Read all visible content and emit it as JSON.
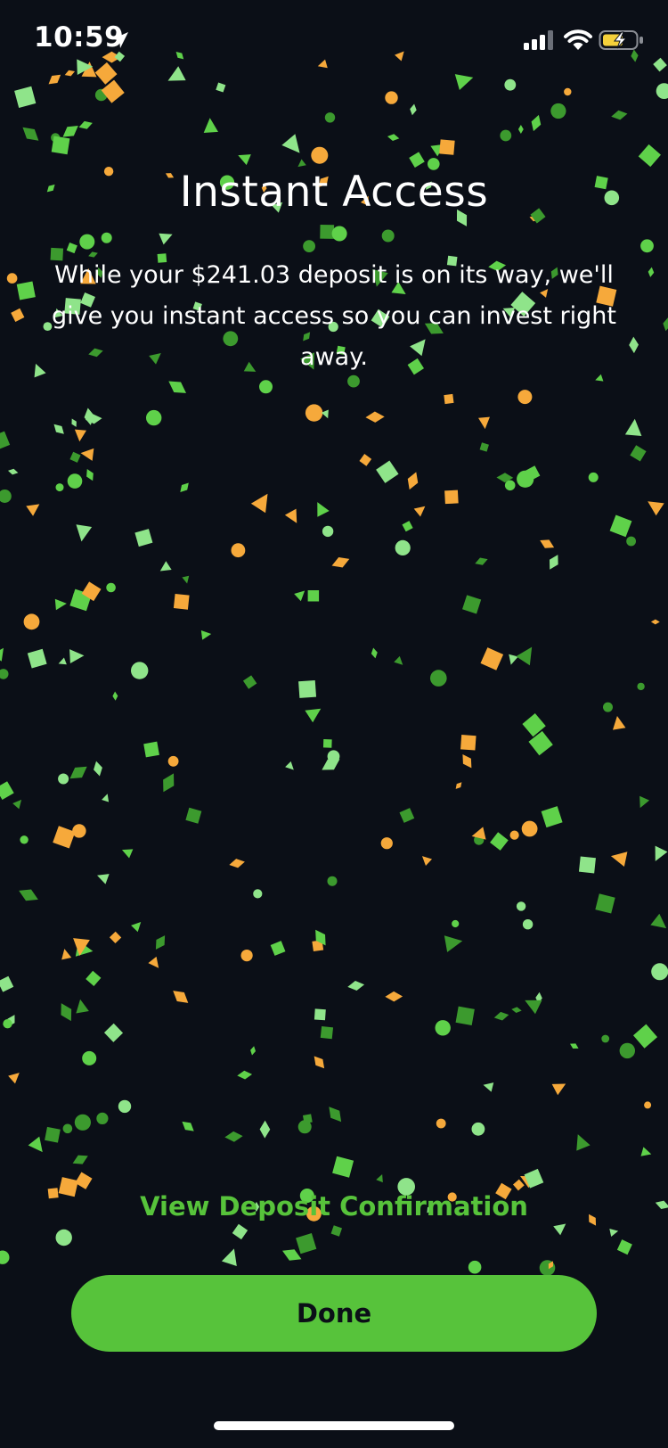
{
  "status_bar": {
    "time": "10:59",
    "location_icon": "location-arrow-icon",
    "signal_icon": "cellular-signal-icon",
    "wifi_icon": "wifi-icon",
    "battery_icon": "battery-charging-icon"
  },
  "content": {
    "title": "Instant Access",
    "message": "While your $241.03 deposit is on its way, we'll give you instant access so you can invest right away."
  },
  "actions": {
    "view_confirmation": "View Deposit Confirmation",
    "done": "Done"
  },
  "colors": {
    "background": "#0b0f17",
    "accent": "#57c33b",
    "confetti": [
      "#5fd14a",
      "#3c9a2e",
      "#8fe48a",
      "#f6a93b"
    ]
  }
}
